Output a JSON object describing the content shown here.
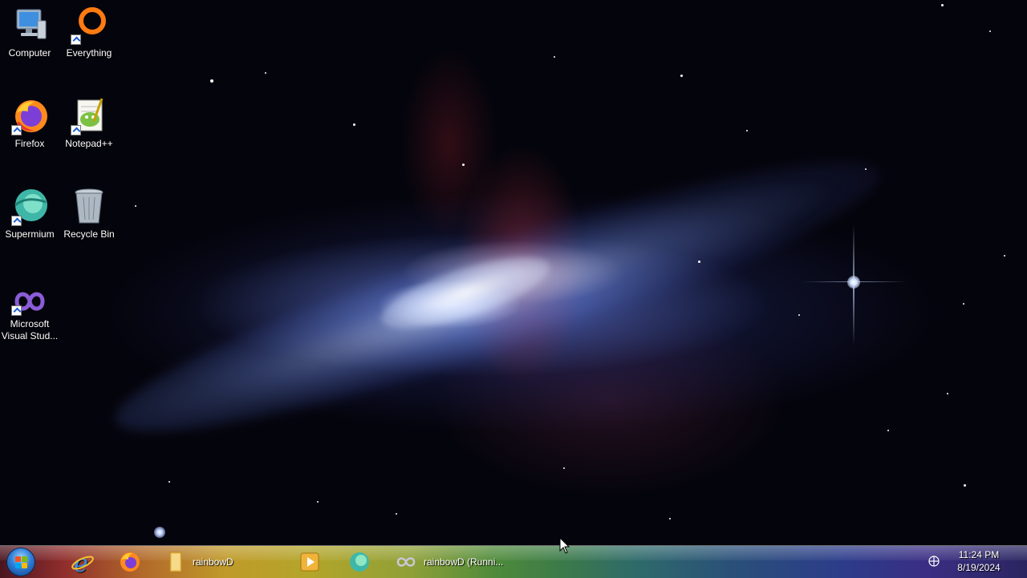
{
  "desktop": {
    "icons": [
      {
        "label": "Computer",
        "icon": "computer-icon",
        "shortcut": false
      },
      {
        "label": "Everything",
        "icon": "everything-icon",
        "shortcut": true
      },
      {
        "label": "Firefox",
        "icon": "firefox-icon",
        "shortcut": true
      },
      {
        "label": "Notepad++",
        "icon": "notepadpp-icon",
        "shortcut": true
      },
      {
        "label": "Supermium",
        "icon": "supermium-icon",
        "shortcut": true
      },
      {
        "label": "Recycle Bin",
        "icon": "recycle-bin-icon",
        "shortcut": false
      },
      {
        "label": "Microsoft Visual Stud...",
        "icon": "visual-studio-icon",
        "shortcut": true
      }
    ]
  },
  "taskbar": {
    "start_icon": "windows-start-orb",
    "items": [
      {
        "label": "",
        "icon": "internet-explorer-icon"
      },
      {
        "label": "",
        "icon": "firefox-icon"
      },
      {
        "label": "rainbowD",
        "icon": "folder-icon"
      },
      {
        "label": "",
        "icon": "media-player-icon"
      },
      {
        "label": "",
        "icon": "supermium-icon"
      },
      {
        "label": "rainbowD (Runni...",
        "icon": "visual-studio-icon"
      }
    ],
    "tray": {
      "icon": "network-icon"
    },
    "clock": {
      "time": "11:24 PM",
      "date": "8/19/2024"
    }
  },
  "colors": {
    "taskbar_left": "#8e2c2c",
    "taskbar_mid": "#4f8b3a",
    "taskbar_right": "#3a2e84",
    "desktop_bg": "#04040c"
  }
}
